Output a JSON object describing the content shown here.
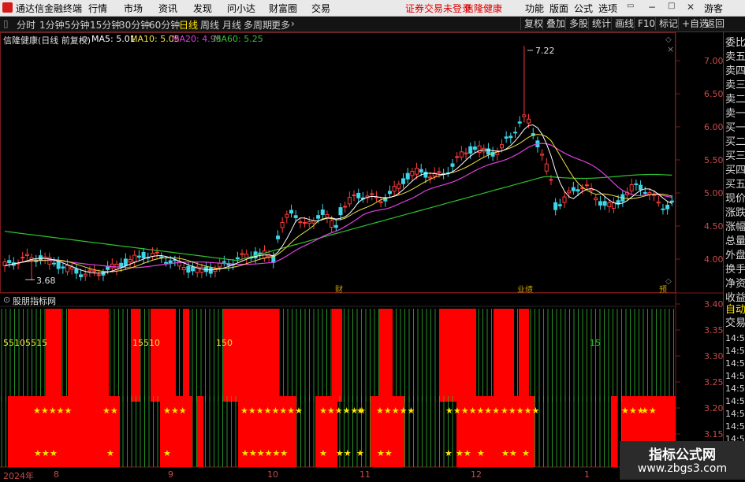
{
  "titlebar": {
    "app_title": "通达信金融终端",
    "menu": [
      "行情",
      "市场",
      "资讯",
      "发现",
      "问小达",
      "财富圈",
      "交易"
    ],
    "notice": "证券交易未登录",
    "stock_name": "信隆健康",
    "right_menu": [
      "功能",
      "版面",
      "公式",
      "选项"
    ],
    "user": "游客"
  },
  "toolbar": {
    "periods": [
      "分时",
      "1分钟",
      "5分钟",
      "15分钟",
      "30分钟",
      "60分钟",
      "日线",
      "周线",
      "月线",
      "多周期",
      "更多"
    ],
    "selected_period": "日线",
    "right_buttons": [
      "复权",
      "叠加",
      "多股",
      "统计",
      "画线",
      "F10",
      "标记",
      "+自选",
      "返回"
    ]
  },
  "main_chart": {
    "header_name": "信隆健康(日线 前复权)",
    "ma5": "MA5: 5.01",
    "ma10": "MA10: 5.05",
    "ma20": "MA20: 4.95",
    "ma60": "MA60: 5.25",
    "high_label": "7.22",
    "low_label": "3.68",
    "event_marks": [
      "财",
      "业绩",
      "预"
    ],
    "colors": {
      "up": "#ff3b3b",
      "down": "#3cd6e8",
      "ma5": "#ffffff",
      "ma10": "#f0e040",
      "ma20": "#e040e0",
      "ma60": "#30c030"
    }
  },
  "price_axis": [
    "7.00",
    "6.50",
    "6.00",
    "5.50",
    "5.00",
    "4.50",
    "4.00"
  ],
  "indicator": {
    "name": "股朋指标网",
    "labels": [
      "55105515",
      "15510",
      "150",
      "15"
    ],
    "axis": [
      "3.40",
      "3.35",
      "3.30",
      "3.25",
      "3.20",
      "3.15"
    ],
    "stars_top": [
      "★★★★★",
      "★★",
      "★★★",
      "★★★★★★★★",
      "★★★★★★",
      "★",
      "★★★★★",
      "★★★★★★★",
      "★★★★★",
      "★★★",
      "★★"
    ],
    "stars_bottom": [
      "★★",
      "★",
      "★",
      "★",
      "★★★★★★",
      "★",
      "★★",
      "★",
      "★★",
      "★",
      "★★",
      "★",
      "★★",
      "★"
    ]
  },
  "date_axis": [
    "2024年",
    "8",
    "9",
    "10",
    "11",
    "12",
    "1"
  ],
  "right_panel": {
    "items": [
      "委比",
      "卖五",
      "卖四",
      "卖三",
      "卖二",
      "卖一",
      "买一",
      "买二",
      "买三",
      "买四",
      "买五",
      "现价",
      "涨跌",
      "涨幅",
      "总量",
      "外盘",
      "换手",
      "净资",
      "收益"
    ],
    "lower_items": [
      "自动",
      "交易"
    ],
    "times": [
      "14:56",
      "14:56",
      "14:56",
      "14:56",
      "14:56",
      "14:56",
      "14:56",
      "14:56",
      "14:56"
    ]
  },
  "watermark": {
    "line1": "指标公式网",
    "line2": "www.zbgs3.com"
  }
}
